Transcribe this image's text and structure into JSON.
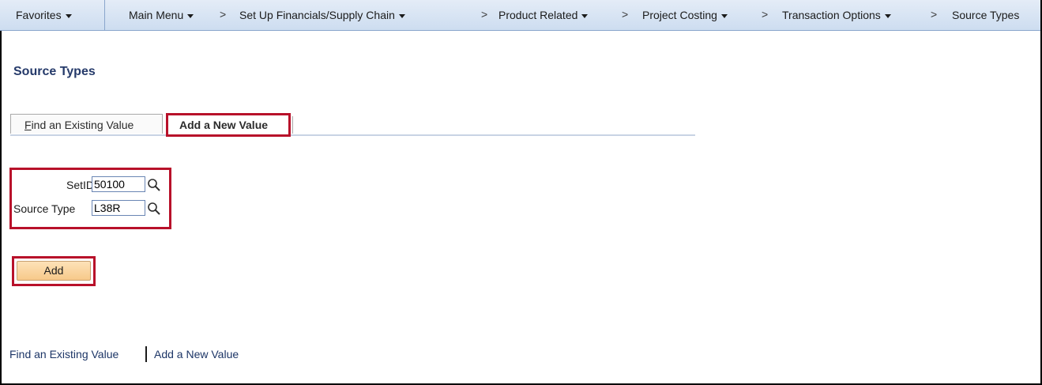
{
  "navbar": {
    "favorites": "Favorites",
    "main_menu": "Main Menu",
    "breadcrumbs": [
      "Set Up Financials/Supply Chain",
      "Product Related",
      "Project Costing",
      "Transaction Options",
      "Source Types"
    ],
    "separator": ">"
  },
  "page": {
    "title": "Source Types"
  },
  "tabs": {
    "find_prefix": "F",
    "find_rest": "ind an Existing Value",
    "add": "Add a New Value"
  },
  "form": {
    "setid_label": "SetID",
    "setid_value": "50100",
    "source_type_label": "Source Type",
    "source_type_value": "L38R",
    "add_button": "Add"
  },
  "footer_links": {
    "find": "Find an Existing Value",
    "add": "Add a New Value"
  },
  "colors": {
    "highlight_border": "#b8112a",
    "title": "#253a6a",
    "navbar_bg": "#d6e3f3"
  }
}
